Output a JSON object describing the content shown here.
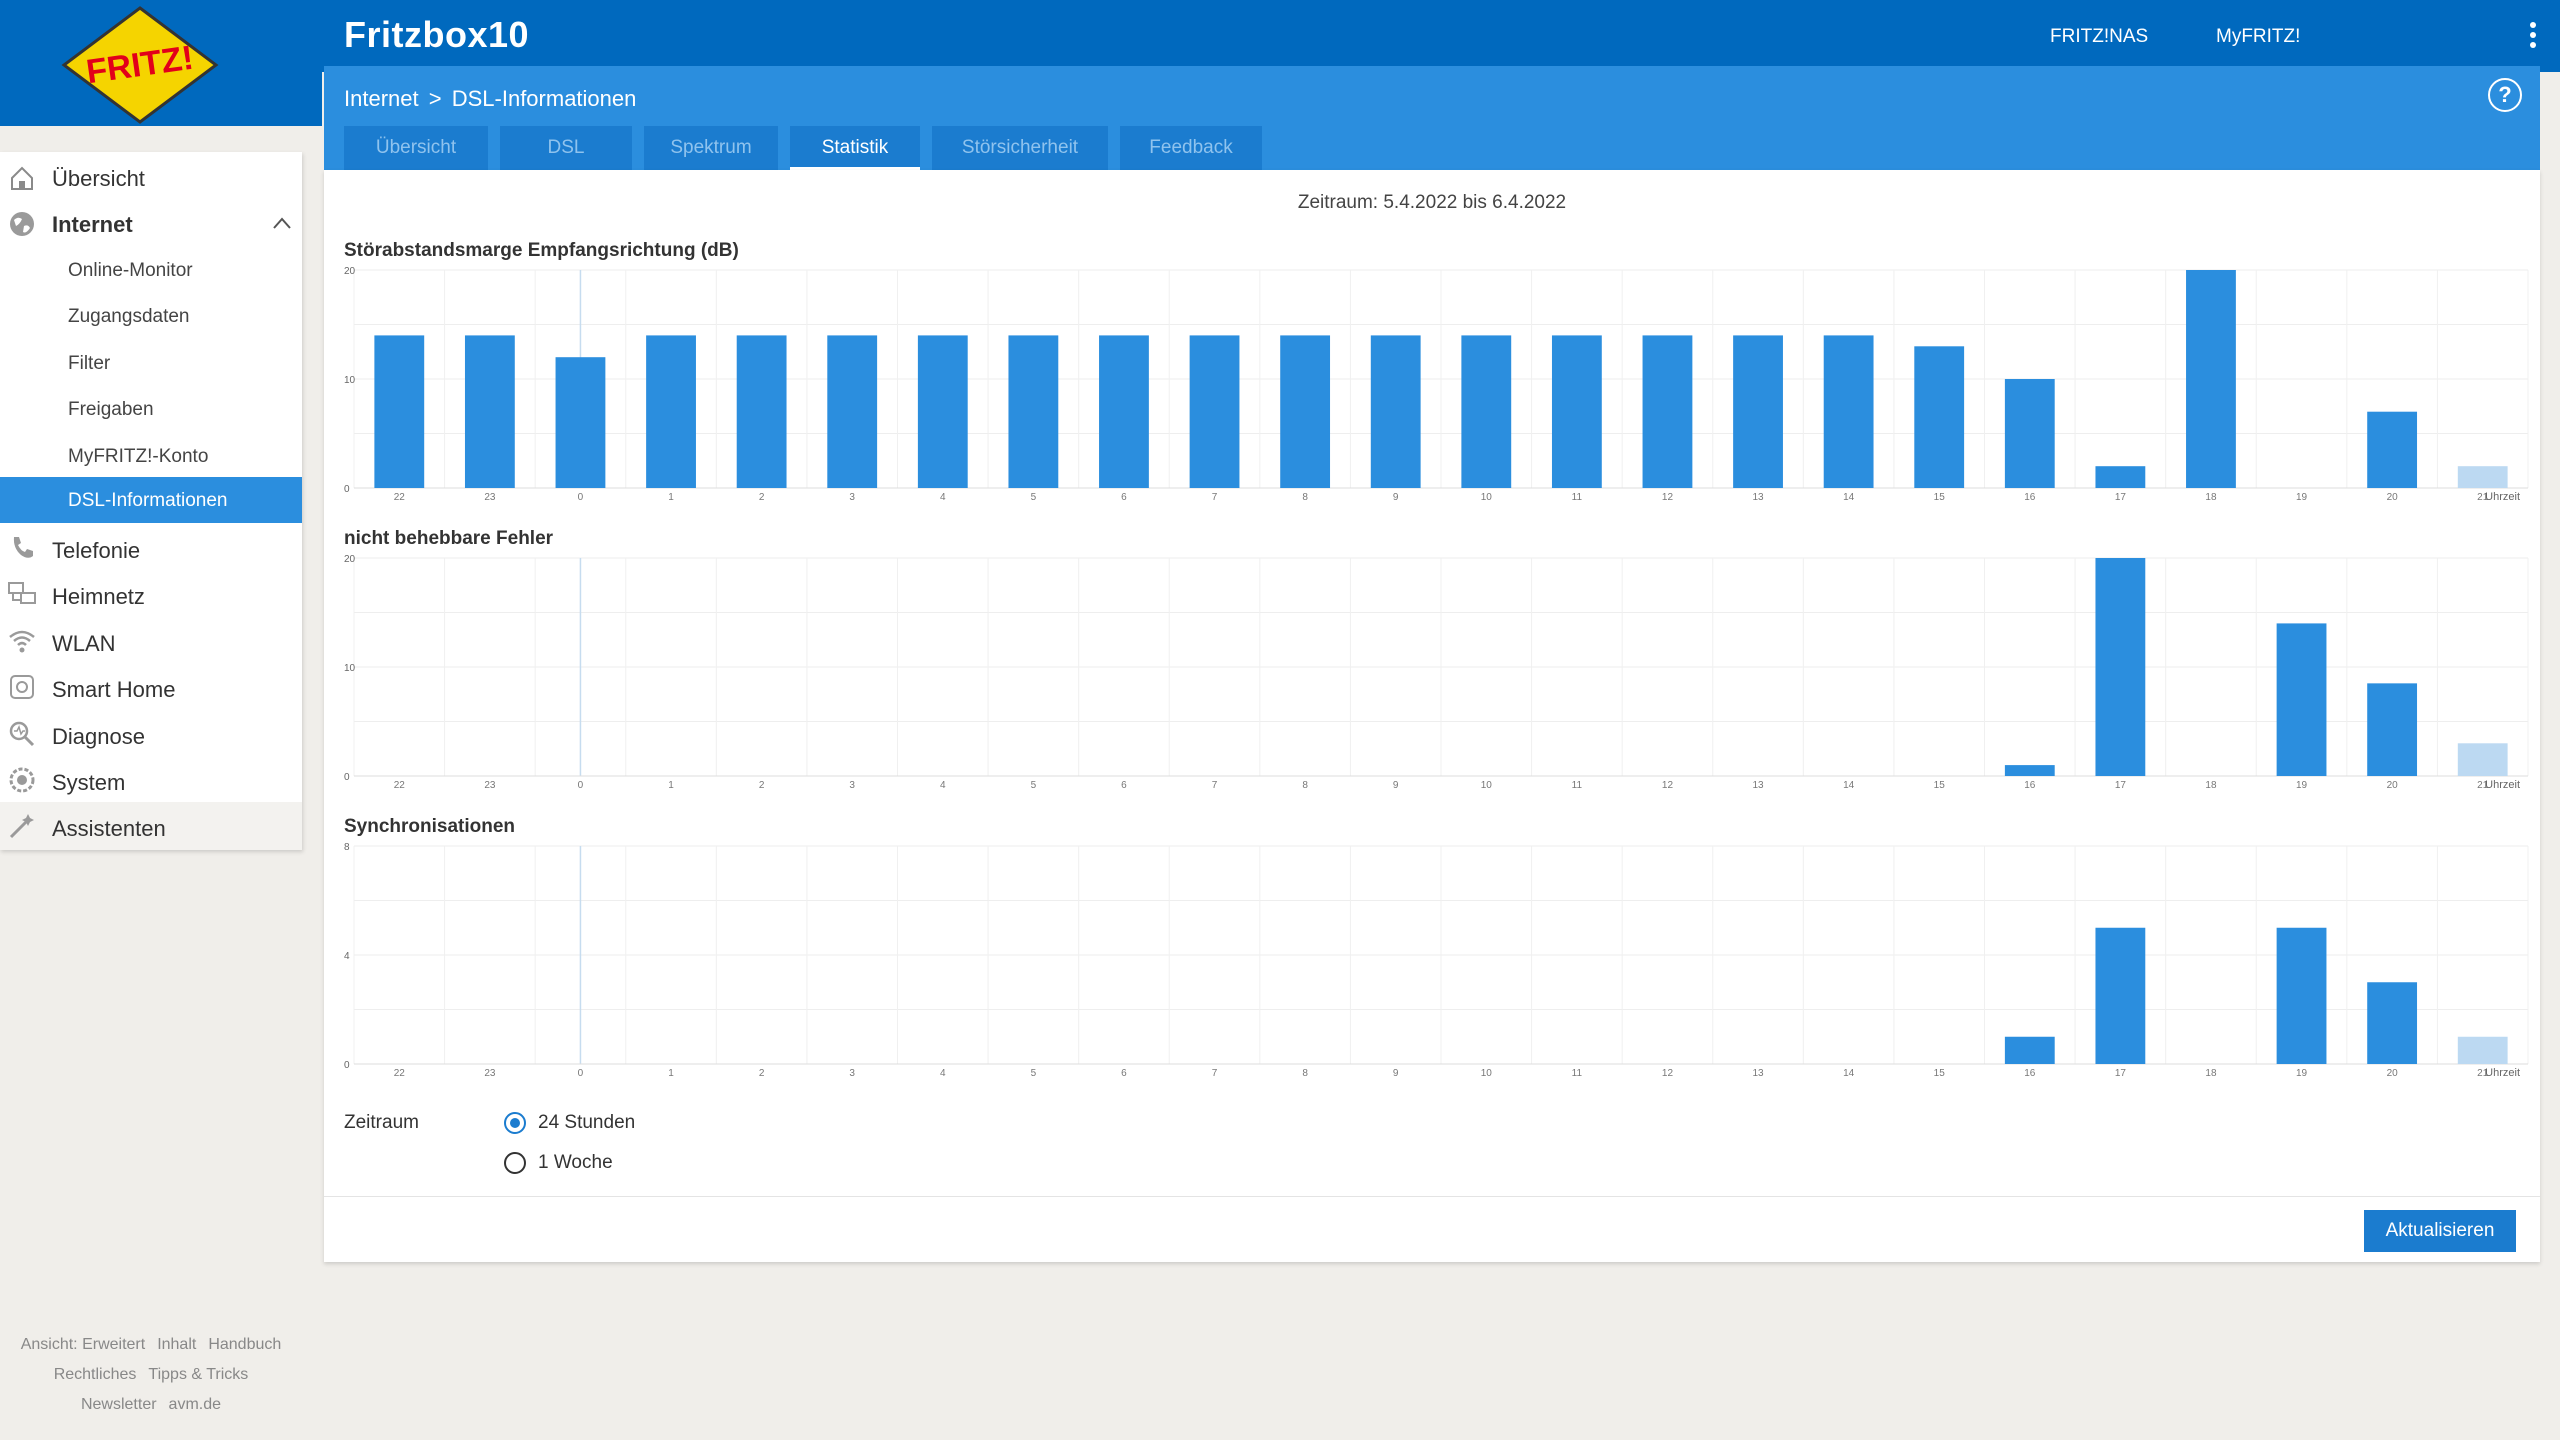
{
  "app": {
    "title": "Fritzbox10"
  },
  "topnav": {
    "nas": "FRITZ!NAS",
    "myfritz": "MyFRITZ!"
  },
  "breadcrumb": {
    "section": "Internet",
    "separator": ">",
    "page": "DSL-Informationen"
  },
  "help": {
    "label": "?"
  },
  "tabs": [
    {
      "label": "Übersicht",
      "active": false
    },
    {
      "label": "DSL",
      "active": false
    },
    {
      "label": "Spektrum",
      "active": false
    },
    {
      "label": "Statistik",
      "active": true
    },
    {
      "label": "Störsicherheit",
      "active": false
    },
    {
      "label": "Feedback",
      "active": false
    }
  ],
  "sidebar": {
    "items": [
      {
        "label": "Übersicht",
        "icon": "home-icon"
      },
      {
        "label": "Internet",
        "icon": "globe-icon",
        "expanded": true
      },
      {
        "label": "Online-Monitor"
      },
      {
        "label": "Zugangsdaten"
      },
      {
        "label": "Filter"
      },
      {
        "label": "Freigaben"
      },
      {
        "label": "MyFRITZ!-Konto"
      },
      {
        "label": "DSL-Informationen",
        "active": true
      },
      {
        "label": "Telefonie",
        "icon": "phone-icon"
      },
      {
        "label": "Heimnetz",
        "icon": "network-icon"
      },
      {
        "label": "WLAN",
        "icon": "wifi-icon"
      },
      {
        "label": "Smart Home",
        "icon": "smarthome-icon"
      },
      {
        "label": "Diagnose",
        "icon": "diagnose-icon"
      },
      {
        "label": "System",
        "icon": "system-icon"
      },
      {
        "label": "Assistenten",
        "icon": "wizard-icon"
      }
    ]
  },
  "footer": {
    "ansicht": "Ansicht: Erweitert",
    "inhalt": "Inhalt",
    "handbuch": "Handbuch",
    "rechtliches": "Rechtliches",
    "tipps": "Tipps & Tricks",
    "newsletter": "Newsletter",
    "avm": "avm.de"
  },
  "main": {
    "period": "Zeitraum: 5.4.2022 bis 6.4.2022"
  },
  "chart_data": [
    {
      "type": "bar",
      "title": "Störabstandsmarge Empfangsrichtung (dB)",
      "xlabel": "Uhrzeit",
      "categories": [
        "22",
        "23",
        "0",
        "1",
        "2",
        "3",
        "4",
        "5",
        "6",
        "7",
        "8",
        "9",
        "10",
        "11",
        "12",
        "13",
        "14",
        "15",
        "16",
        "17",
        "18",
        "19",
        "20",
        "21"
      ],
      "values": [
        14,
        14,
        12,
        14,
        14,
        14,
        14,
        14,
        14,
        14,
        14,
        14,
        14,
        14,
        14,
        14,
        14,
        13,
        10,
        2,
        20,
        0,
        7,
        2
      ],
      "y_ticks": [
        "0",
        "10",
        "20"
      ],
      "ylim": [
        0,
        20
      ],
      "current_index": 23,
      "grid": true
    },
    {
      "type": "bar",
      "title": "nicht behebbare Fehler",
      "xlabel": "Uhrzeit",
      "categories": [
        "22",
        "23",
        "0",
        "1",
        "2",
        "3",
        "4",
        "5",
        "6",
        "7",
        "8",
        "9",
        "10",
        "11",
        "12",
        "13",
        "14",
        "15",
        "16",
        "17",
        "18",
        "19",
        "20",
        "21"
      ],
      "values": [
        0,
        0,
        0,
        0,
        0,
        0,
        0,
        0,
        0,
        0,
        0,
        0,
        0,
        0,
        0,
        0,
        0,
        0,
        1,
        20,
        0,
        14,
        8.5,
        3
      ],
      "y_ticks": [
        "0",
        "10",
        "20"
      ],
      "ylim": [
        0,
        20
      ],
      "current_index": 23,
      "grid": true
    },
    {
      "type": "bar",
      "title": "Synchronisationen",
      "xlabel": "Uhrzeit",
      "categories": [
        "22",
        "23",
        "0",
        "1",
        "2",
        "3",
        "4",
        "5",
        "6",
        "7",
        "8",
        "9",
        "10",
        "11",
        "12",
        "13",
        "14",
        "15",
        "16",
        "17",
        "18",
        "19",
        "20",
        "21"
      ],
      "values": [
        0,
        0,
        0,
        0,
        0,
        0,
        0,
        0,
        0,
        0,
        0,
        0,
        0,
        0,
        0,
        0,
        0,
        0,
        1,
        5,
        0,
        5,
        3,
        1
      ],
      "y_ticks": [
        "0",
        "4",
        "8"
      ],
      "ylim": [
        0,
        8
      ],
      "current_index": 23,
      "grid": true
    }
  ],
  "colors": {
    "bar": "#2b8ede",
    "bar_current": "#bcd9f2",
    "header": "#0069be",
    "subheader": "#2b8ede"
  },
  "zeitraum": {
    "label": "Zeitraum",
    "option_24h": "24 Stunden",
    "option_week": "1 Woche",
    "selected": "24 Stunden"
  },
  "actions": {
    "refresh": "Aktualisieren"
  }
}
